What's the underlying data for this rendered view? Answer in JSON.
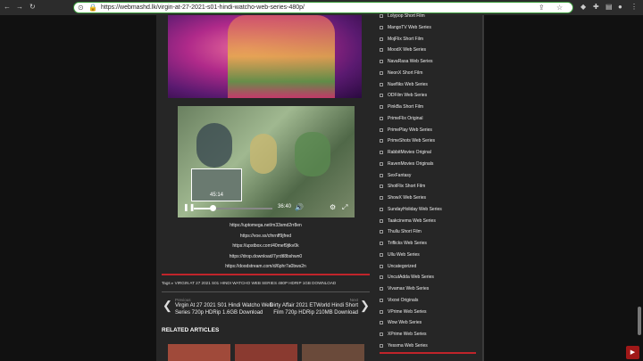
{
  "browser": {
    "url": "https://webmashd.lk/virgin-at-27-2021-s01-hindi-watcho-web-series-480p/"
  },
  "icons": {
    "back": "back-icon",
    "forward": "forward-icon",
    "reload": "reload-icon",
    "lock": "lock-icon",
    "bookmark": "star-icon",
    "share": "share-icon"
  },
  "player": {
    "thumb_time": "45:14",
    "duration": "36:40",
    "progress": 0.24
  },
  "links": [
    "https://uptomega.net/m33smd2rr8en",
    "https://voe.sx/cfnrnff9jfred",
    "https://upstbox.com/40mef9jtkv0k",
    "https://drop.download/7yrdtl8bshwn0",
    "https://doodstream.com/d/6phr7a0bws2n"
  ],
  "tags": {
    "label": "Tags",
    "value": "VIRGIN AT 27 2021 S01 HINDI WATCHO WEB SERIES 480P HDRIP 1GB DOWNLOAD"
  },
  "nav": {
    "prev_label": "Previous",
    "prev_title": "Virgin At 27 2021 S01 Hindi Watcho Web Series 720p HDRip 1.6GB Download",
    "next_label": "Next",
    "next_title": "Dirty Affair 2021 ETWorld Hindi Short Film 720p HDRip 210MB Download"
  },
  "related_title": "RELATED ARTICLES",
  "sidebar": {
    "items": [
      "Lolypop Short Film",
      "MangoTV Web Series",
      "MojFlix Short Film",
      "MoodX Web Series",
      "NavaRasa Web Series",
      "NeonX Short Film",
      "Nuefliks Web Series",
      "ODFilm Web Series",
      "PinkBa Short Film",
      "PrimeFlix Original",
      "PrimePlay Web Series",
      "PrimeShots Web Series",
      "RabbitMovies Original",
      "RavenMovies Originals",
      "SexFantasy",
      "ShotFlix Short Film",
      "ShowX Web Series",
      "SundayHoliday Web Series",
      "Taakcinema Web Series",
      "Thullu Short Film",
      "Triflicks Web Series",
      "Ullu Web Series",
      "Uncategorized",
      "UncutAdda Web Series",
      "Vivamax Web Series",
      "Vixovi Originals",
      "VPrime Web Series",
      "Wow Web Series",
      "XPrime Web Series",
      "Yessma Web Series"
    ]
  },
  "colors": {
    "accent_red": "#c0242a",
    "panel": "#262626"
  }
}
